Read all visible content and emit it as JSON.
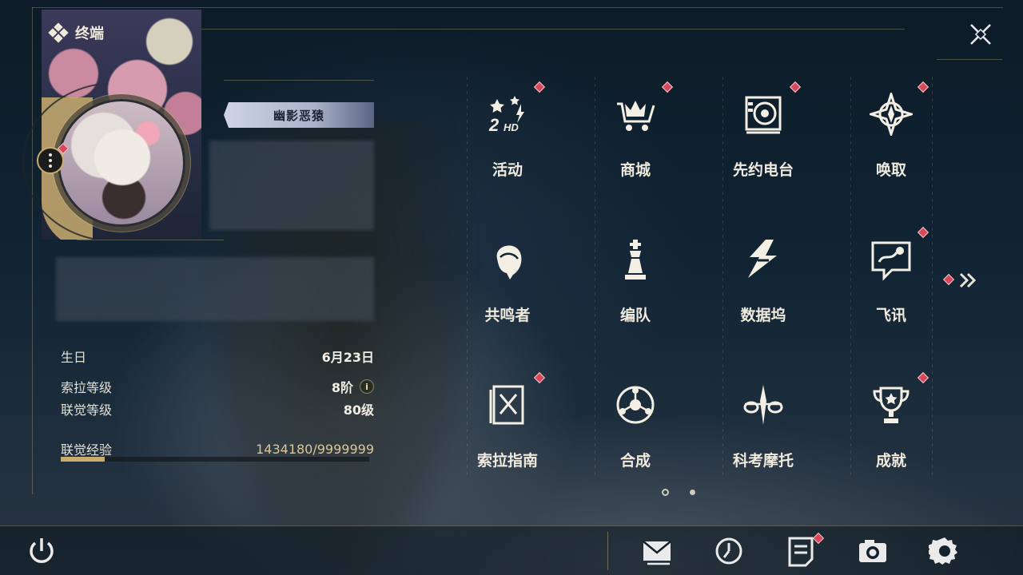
{
  "header": {
    "title": "终端"
  },
  "profile": {
    "nickname": "幽影恶猿",
    "stats": [
      {
        "label": "生日",
        "value": "6月23日"
      },
      {
        "label": "索拉等级",
        "value": "8阶",
        "info": "i"
      },
      {
        "label": "联觉等级",
        "value": "80级"
      }
    ],
    "exp": {
      "label": "联觉经验",
      "value": "1434180/9999999",
      "progress": 0.143
    }
  },
  "menu": {
    "items": [
      {
        "label": "活动",
        "icon": "event-2hd-icon",
        "badge": true
      },
      {
        "label": "商城",
        "icon": "shop-crown-cart-icon",
        "badge": true
      },
      {
        "label": "先约电台",
        "icon": "radio-pass-icon",
        "badge": true
      },
      {
        "label": "唤取",
        "icon": "convene-star-icon",
        "badge": true
      },
      {
        "label": "共鸣者",
        "icon": "resonator-portrait-icon",
        "badge": false
      },
      {
        "label": "编队",
        "icon": "team-chess-icon",
        "badge": false
      },
      {
        "label": "数据坞",
        "icon": "data-bank-icon",
        "badge": false
      },
      {
        "label": "飞讯",
        "icon": "chat-message-icon",
        "badge": true
      },
      {
        "label": "索拉指南",
        "icon": "guidebook-icon",
        "badge": true
      },
      {
        "label": "合成",
        "icon": "synthesis-icon",
        "badge": false
      },
      {
        "label": "科考摩托",
        "icon": "motorcycle-icon",
        "badge": false
      },
      {
        "label": "成就",
        "icon": "trophy-icon",
        "badge": true
      }
    ],
    "pagination": {
      "current": 1,
      "total": 2
    }
  },
  "bottom_bar": {
    "buttons": [
      "power-icon",
      "mail-icon",
      "clock-icon",
      "notes-icon",
      "camera-icon",
      "settings-gear-icon"
    ]
  },
  "colors": {
    "accent_gold": "#c9ad6e",
    "badge_red": "#d9485a",
    "text": "#efeadd"
  }
}
